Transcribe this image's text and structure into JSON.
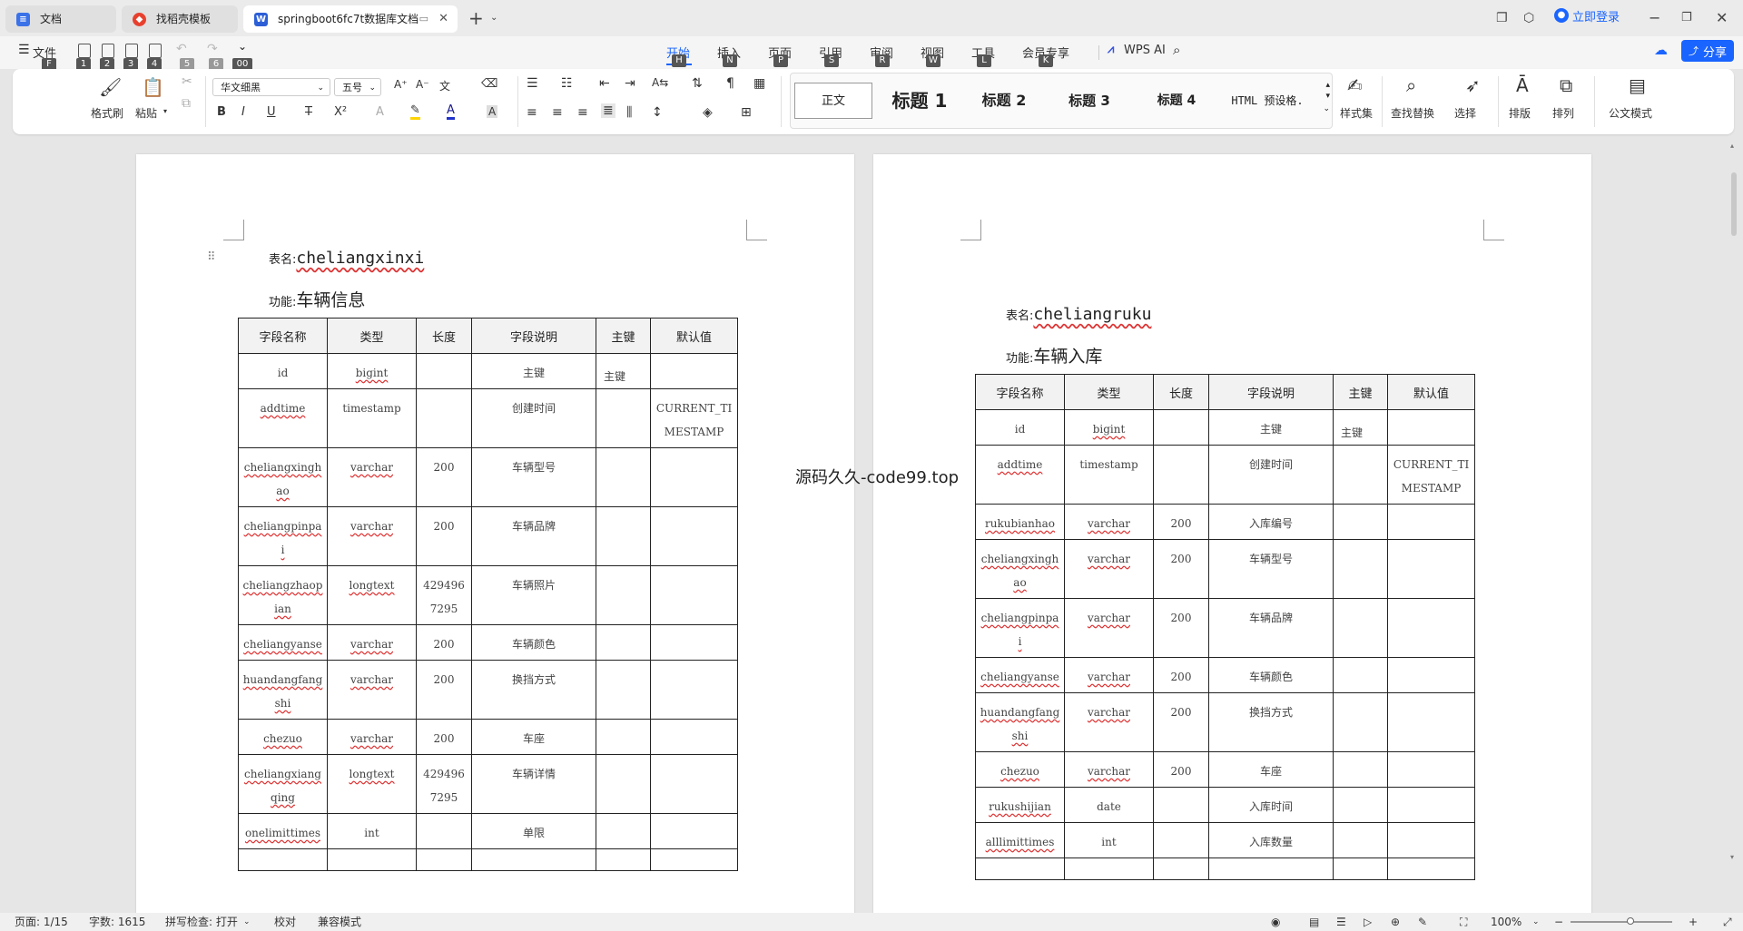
{
  "tabs": [
    {
      "label": "文档",
      "icon": "docs-icon",
      "color": "#3b72e8",
      "active": false
    },
    {
      "label": "找稻壳模板",
      "icon": "docer-icon",
      "color": "#e8402e",
      "active": false
    },
    {
      "label": "springboot6fc7t数据库文档",
      "icon": "word-doc-icon",
      "color": "#2c5fd6",
      "active": true
    }
  ],
  "titlebar": {
    "login": "立即登录",
    "new_tab": "+"
  },
  "menubar": {
    "file": "文件",
    "file_key": "F",
    "quick_keys": [
      "1",
      "2",
      "3",
      "4",
      "5",
      "6",
      "00"
    ],
    "items": [
      {
        "label": "开始",
        "key": "H",
        "active": true
      },
      {
        "label": "插入",
        "key": "N"
      },
      {
        "label": "页面",
        "key": "P"
      },
      {
        "label": "引用",
        "key": "S"
      },
      {
        "label": "审阅",
        "key": "R"
      },
      {
        "label": "视图",
        "key": "W"
      },
      {
        "label": "工具",
        "key": "L"
      },
      {
        "label": "会员专享",
        "key": "K"
      }
    ],
    "wps_ai": "WPS AI",
    "share": "分享"
  },
  "ribbon": {
    "format_painter": "格式刷",
    "paste": "粘贴",
    "font_name": "华文细黑",
    "font_size": "五号",
    "styles": [
      "正文",
      "标题 1",
      "标题 2",
      "标题 3",
      "标题 4",
      "HTML 预设格."
    ],
    "style_set": "样式集",
    "find_replace": "查找替换",
    "select": "选择",
    "layout": "排版",
    "arrange": "排列",
    "official": "公文模式"
  },
  "columns": [
    "字段名称",
    "类型",
    "长度",
    "字段说明",
    "主键",
    "默认值"
  ],
  "doc_left": {
    "table_label": "表名:",
    "table_name": "cheliangxinxi",
    "func_label": "功能:",
    "func": "车辆信息",
    "rows": [
      {
        "name": "id",
        "type": "bigint",
        "len": "",
        "desc": "主键",
        "pk": "主键",
        "def": ""
      },
      {
        "name": "addtime",
        "type": "timestamp",
        "len": "",
        "desc": "创建时间",
        "pk": "",
        "def": "CURRENT_TIMESTAMP"
      },
      {
        "name": "cheliangxinghao",
        "type": "varchar",
        "len": "200",
        "desc": "车辆型号",
        "pk": "",
        "def": ""
      },
      {
        "name": "cheliangpinpai",
        "type": "varchar",
        "len": "200",
        "desc": "车辆品牌",
        "pk": "",
        "def": ""
      },
      {
        "name": "cheliangzhaopian",
        "type": "longtext",
        "len": "4294967295",
        "desc": "车辆照片",
        "pk": "",
        "def": ""
      },
      {
        "name": "cheliangyanse",
        "type": "varchar",
        "len": "200",
        "desc": "车辆颜色",
        "pk": "",
        "def": ""
      },
      {
        "name": "huandangfangshi",
        "type": "varchar",
        "len": "200",
        "desc": "换挡方式",
        "pk": "",
        "def": ""
      },
      {
        "name": "chezuo",
        "type": "varchar",
        "len": "200",
        "desc": "车座",
        "pk": "",
        "def": ""
      },
      {
        "name": "cheliangxiangqing",
        "type": "longtext",
        "len": "4294967295",
        "desc": "车辆详情",
        "pk": "",
        "def": ""
      },
      {
        "name": "onelimittimes",
        "type": "int",
        "len": "",
        "desc": "单限",
        "pk": "",
        "def": ""
      },
      {
        "name": "",
        "type": "",
        "len": "",
        "desc": "",
        "pk": "",
        "def": ""
      }
    ]
  },
  "doc_right": {
    "table_label": "表名:",
    "table_name": "cheliangruku",
    "func_label": "功能:",
    "func": "车辆入库",
    "rows": [
      {
        "name": "id",
        "type": "bigint",
        "len": "",
        "desc": "主键",
        "pk": "主键",
        "def": ""
      },
      {
        "name": "addtime",
        "type": "timestamp",
        "len": "",
        "desc": "创建时间",
        "pk": "",
        "def": "CURRENT_TIMESTAMP"
      },
      {
        "name": "rukubianhao",
        "type": "varchar",
        "len": "200",
        "desc": "入库编号",
        "pk": "",
        "def": ""
      },
      {
        "name": "cheliangxinghao",
        "type": "varchar",
        "len": "200",
        "desc": "车辆型号",
        "pk": "",
        "def": ""
      },
      {
        "name": "cheliangpinpai",
        "type": "varchar",
        "len": "200",
        "desc": "车辆品牌",
        "pk": "",
        "def": ""
      },
      {
        "name": "cheliangyanse",
        "type": "varchar",
        "len": "200",
        "desc": "车辆颜色",
        "pk": "",
        "def": ""
      },
      {
        "name": "huandangfangshi",
        "type": "varchar",
        "len": "200",
        "desc": "换挡方式",
        "pk": "",
        "def": ""
      },
      {
        "name": "chezuo",
        "type": "varchar",
        "len": "200",
        "desc": "车座",
        "pk": "",
        "def": ""
      },
      {
        "name": "rukushijian",
        "type": "date",
        "len": "",
        "desc": "入库时间",
        "pk": "",
        "def": ""
      },
      {
        "name": "alllimittimes",
        "type": "int",
        "len": "",
        "desc": "入库数量",
        "pk": "",
        "def": ""
      },
      {
        "name": "",
        "type": "",
        "len": "",
        "desc": "",
        "pk": "",
        "def": ""
      }
    ]
  },
  "watermark": "源码久久-code99.top",
  "status": {
    "page": "页面: 1/15",
    "words": "字数: 1615",
    "spell": "拼写检查: 打开",
    "proof": "校对",
    "compat": "兼容模式",
    "zoom": "100%",
    "zoom_level": 100
  }
}
